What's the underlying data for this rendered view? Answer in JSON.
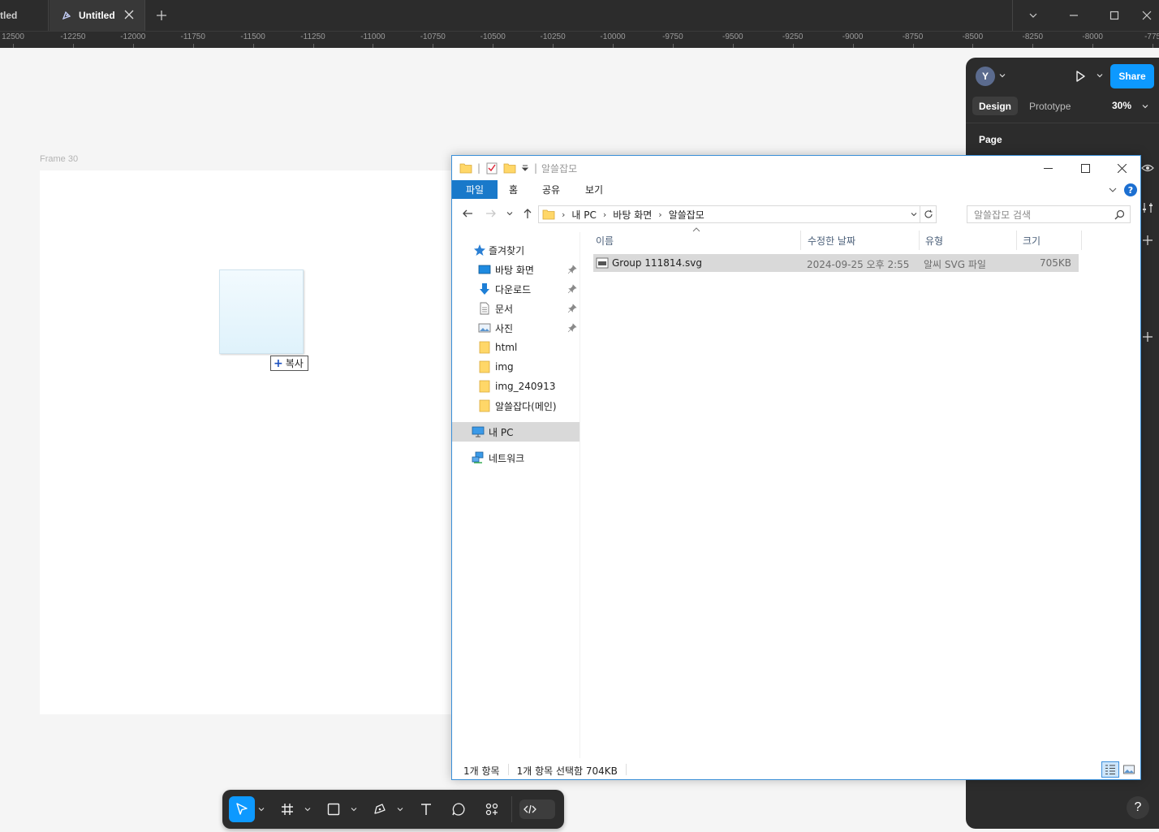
{
  "figma": {
    "tabs": {
      "prev": "tled",
      "active": "Untitled"
    },
    "ruler_ticks": [
      "12500",
      "-12250",
      "-12000",
      "-11750",
      "-11500",
      "-11250",
      "-11000",
      "-10750",
      "-10500",
      "-10250",
      "-10000",
      "-9750",
      "-9500",
      "-9250",
      "-9000",
      "-8750",
      "-8500",
      "-8250",
      "-8000",
      "-775"
    ],
    "canvas": {
      "frame_label": "Frame 30",
      "drag_tooltip": "복사",
      "drag_tooltip_plus": "+"
    },
    "right_panel": {
      "avatar_initial": "Y",
      "share_label": "Share",
      "tab_design": "Design",
      "tab_prototype": "Prototype",
      "zoom": "30%",
      "page_label": "Page",
      "help": "?"
    },
    "colors": {
      "accent": "#0d99ff",
      "chrome": "#2c2c2c"
    }
  },
  "explorer": {
    "title": "알쓸잡모",
    "ribbon_tabs": [
      "파일",
      "홈",
      "공유",
      "보기"
    ],
    "help": "?",
    "address": [
      "내 PC",
      "바탕 화면",
      "알쓸잡모"
    ],
    "search_placeholder": "알쓸잡모 검색",
    "tree": {
      "quick_access": "즐겨찾기",
      "desktop": "바탕 화면",
      "downloads": "다운로드",
      "documents": "문서",
      "pictures": "사진",
      "html": "html",
      "img": "img",
      "img_240913": "img_240913",
      "main": "알쓸잡다(메인)",
      "this_pc": "내 PC",
      "network": "네트워크"
    },
    "columns": {
      "name": "이름",
      "modified": "수정한 날짜",
      "type": "유형",
      "size": "크기"
    },
    "files": [
      {
        "name": "Group 111814.svg",
        "modified": "2024-09-25 오후 2:55",
        "type": "알씨 SVG 파일",
        "size": "705KB"
      }
    ],
    "status": {
      "count": "1개 항목",
      "selected": "1개 항목 선택함 704KB"
    },
    "colors": {
      "ribbon_file": "#1979ca",
      "selection": "#d9d9d9"
    }
  }
}
